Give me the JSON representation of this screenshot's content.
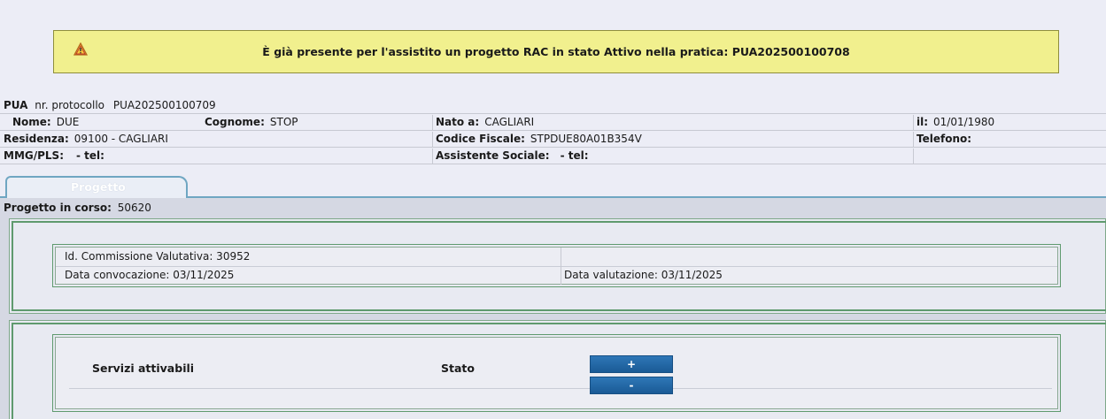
{
  "alert": {
    "message": "È già presente per l'assistito un progetto RAC in stato Attivo nella pratica: PUA202500100708",
    "icon": "warning-icon",
    "color": "#f1f08e"
  },
  "header": {
    "pua_label": "PUA",
    "protocol_label": "nr. protocollo",
    "protocol_value": "PUA202500100709",
    "nome_label": "Nome:",
    "nome_value": "DUE",
    "cognome_label": "Cognome:",
    "cognome_value": "STOP",
    "nato_label": "Nato a:",
    "nato_value": "CAGLIARI",
    "il_label": "il:",
    "il_value": "01/01/1980",
    "residenza_label": "Residenza:",
    "residenza_value": "09100 - CAGLIARI",
    "cf_label": "Codice Fiscale:",
    "cf_value": "STPDUE80A01B354V",
    "telefono_label": "Telefono:",
    "mmg_label": "MMG/PLS:",
    "mmg_tel": "- tel:",
    "assistente_label": "Assistente Sociale:",
    "assistente_tel": "- tel:"
  },
  "tabs": [
    {
      "label": "Progetto"
    }
  ],
  "progetto": {
    "label": "Progetto in corso:",
    "value": "50620"
  },
  "commissione": {
    "id_label": "Id. Commissione Valutativa: 30952",
    "convocazione_label": "Data convocazione: 03/11/2025",
    "valutazione_label": "Data valutazione: 03/11/2025"
  },
  "servizi": {
    "servizi_header": "Servizi attivabili",
    "stato_header": "Stato",
    "add_label": "+",
    "remove_label": "-"
  }
}
